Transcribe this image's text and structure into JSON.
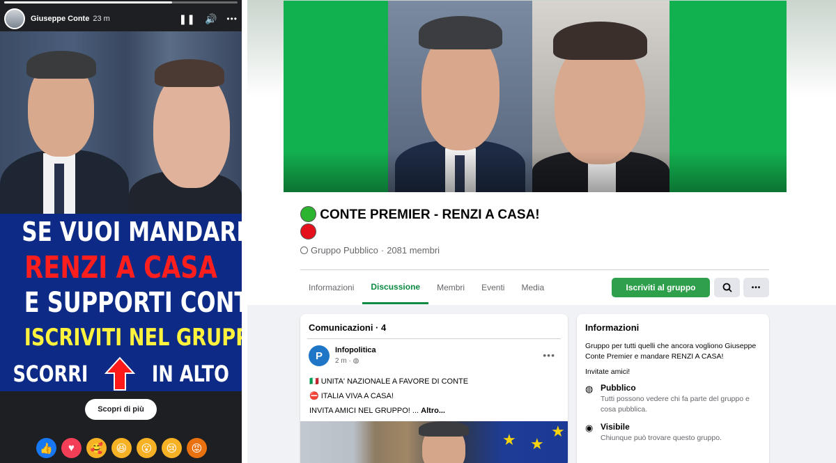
{
  "story": {
    "author": "Giuseppe Conte",
    "time": "23 m",
    "progress": 0.72,
    "controls": {
      "pause_icon": "pause-icon",
      "volume_icon": "volume-icon",
      "more_icon": "more-icon"
    },
    "banner": {
      "line1": "SE VUOI MANDARE",
      "line2": "RENZI A CASA",
      "line3": "E SUPPORTI CONTE",
      "line4": "ISCRIVITI NEL GRUPPO",
      "scroll_left": "SCORRI",
      "scroll_right": "IN ALTO"
    },
    "cta": "Scopri di più",
    "reactions": [
      "like-icon",
      "love-icon",
      "care-icon",
      "haha-icon",
      "wow-icon",
      "sad-icon",
      "angry-icon"
    ],
    "colors": {
      "banner_bg": "#0c2a86",
      "red": "#ff1e1e",
      "yellow": "#fff33d"
    }
  },
  "group": {
    "title": "CONTE PREMIER - RENZI A CASA!",
    "privacy": "Gruppo Pubblico",
    "members": "2081 membri",
    "tabs": [
      "Informazioni",
      "Discussione",
      "Membri",
      "Eventi",
      "Media"
    ],
    "active_tab": "Discussione",
    "join_label": "Iscriviti al gruppo",
    "accent": "#0a8a43",
    "announcements": {
      "title": "Comunicazioni · 4",
      "post": {
        "author": "Infopolitica",
        "time": "2 m",
        "line1": "🇮🇹 UNITA' NAZIONALE A FAVORE DI CONTE",
        "line2": "⛔ ITALIA VIVA A CASA!",
        "line3": "INVITA AMICI NEL GRUPPO! ...",
        "more": "Altro..."
      }
    },
    "info": {
      "title": "Informazioni",
      "description": "Gruppo per tutti quelli che ancora vogliono Giuseppe Conte Premier e mandare RENZI A CASA!",
      "invite": "Invitate amici!",
      "public_title": "Pubblico",
      "public_desc": "Tutti possono vedere chi fa parte del gruppo e cosa pubblica.",
      "visible_title": "Visibile",
      "visible_desc": "Chiunque può trovare questo gruppo."
    }
  }
}
